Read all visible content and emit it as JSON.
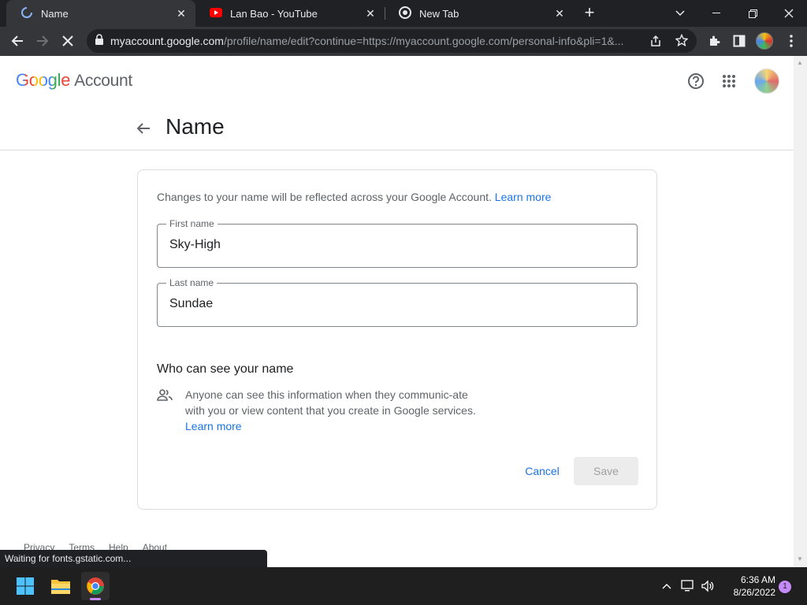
{
  "browser": {
    "tabs": [
      {
        "title": "Name",
        "active": true,
        "loading": true
      },
      {
        "title": "Lan Bao - YouTube",
        "active": false
      },
      {
        "title": "New Tab",
        "active": false
      }
    ],
    "url_host": "myaccount.google.com",
    "url_path": "/profile/name/edit?continue=https://myaccount.google.com/personal-info&pli=1&...",
    "status_text": "Waiting for fonts.gstatic.com..."
  },
  "header": {
    "logo_text": "Google",
    "product": "Account"
  },
  "page": {
    "title": "Name",
    "intro": "Changes to your name will be reflected across your Google Account.",
    "intro_link": "Learn more",
    "first_name_label": "First name",
    "first_name_value": "Sky-High",
    "last_name_label": "Last name",
    "last_name_value": "Sundae",
    "visibility_title": "Who can see your name",
    "visibility_text": "Anyone can see this information when they communic-ate with you or view content that you create in Google services.",
    "visibility_link": "Learn more",
    "cancel_label": "Cancel",
    "save_label": "Save"
  },
  "footer": {
    "links": [
      "Privacy",
      "Terms",
      "Help",
      "About"
    ]
  },
  "taskbar": {
    "time": "6:36 AM",
    "date": "8/26/2022",
    "notifications": "1"
  },
  "colors": {
    "accent": "#1a73e8",
    "tab_strip": "#202124",
    "toolbar": "#35363a"
  }
}
